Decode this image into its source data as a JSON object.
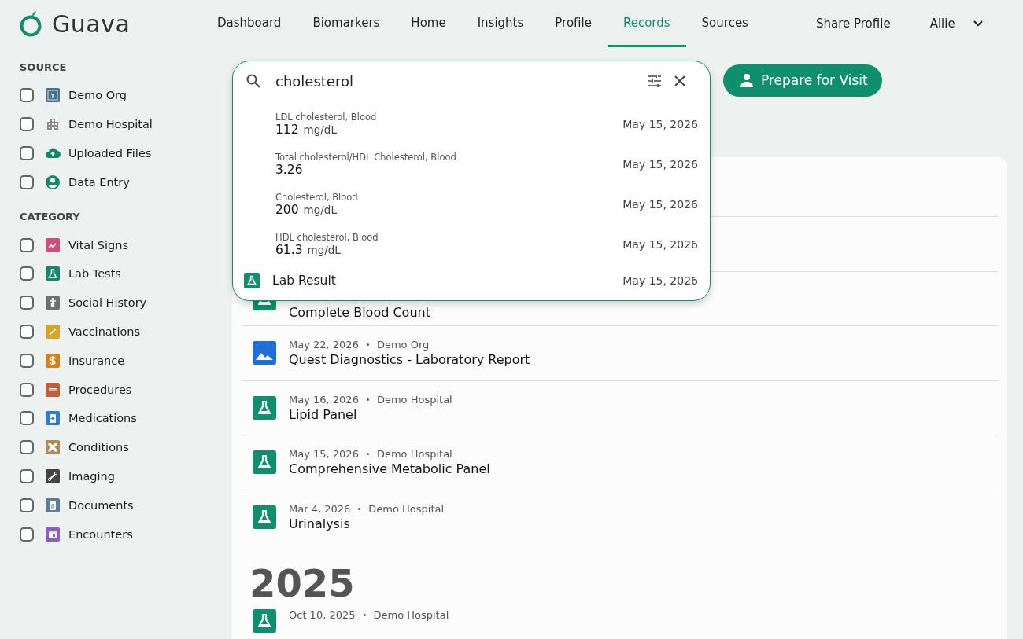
{
  "brand": {
    "name": "Guava"
  },
  "nav": [
    {
      "label": "Dashboard",
      "selected": false
    },
    {
      "label": "Biomarkers",
      "selected": false
    },
    {
      "label": "Home",
      "selected": false
    },
    {
      "label": "Insights",
      "selected": false
    },
    {
      "label": "Profile",
      "selected": false
    },
    {
      "label": "Records",
      "selected": true
    },
    {
      "label": "Sources",
      "selected": false
    }
  ],
  "share": "Share Profile",
  "user": "Allie",
  "sidebar": [
    {
      "title": "SOURCE",
      "items": [
        {
          "label": "Demo Org",
          "checked": false,
          "color": "#4a6f8f"
        },
        {
          "label": "Demo Hospital",
          "checked": false,
          "color": "#8a8a8a"
        },
        {
          "label": "Uploaded Files",
          "checked": false,
          "color": "#12896a"
        },
        {
          "label": "Data Entry",
          "checked": false,
          "color": "#12896a"
        }
      ]
    },
    {
      "title": "CATEGORY",
      "items": [
        {
          "label": "Vital Signs",
          "checked": false,
          "color": "#c9507a"
        },
        {
          "label": "Lab Tests",
          "checked": false,
          "color": "#12896a"
        },
        {
          "label": "Social History",
          "checked": false,
          "color": "#6f6f6f"
        },
        {
          "label": "Vaccinations",
          "checked": false,
          "color": "#d4a52a"
        },
        {
          "label": "Insurance",
          "checked": false,
          "color": "#d4821e"
        },
        {
          "label": "Procedures",
          "checked": false,
          "color": "#c0603a"
        },
        {
          "label": "Medications",
          "checked": false,
          "color": "#2f7ad8"
        },
        {
          "label": "Conditions",
          "checked": false,
          "color": "#b08a5a"
        },
        {
          "label": "Imaging",
          "checked": false,
          "color": "#444444"
        },
        {
          "label": "Documents",
          "checked": false,
          "color": "#5a7f94"
        },
        {
          "label": "Encounters",
          "checked": false,
          "color": "#8a5cc8"
        }
      ]
    }
  ],
  "search": {
    "value": "cholesterol",
    "results": [
      {
        "kind": "observation",
        "label": "LDL cholesterol, Blood",
        "value": "112",
        "unit": "mg/dL",
        "date": "May 15, 2026"
      },
      {
        "kind": "observation",
        "label": "Total cholesterol/HDL Cholesterol, Blood",
        "value": "3.26",
        "date": "May 15, 2026"
      },
      {
        "kind": "observation",
        "label": "Cholesterol, Blood",
        "value": "200",
        "unit": "mg/dL",
        "date": "May 15, 2026"
      },
      {
        "kind": "observation",
        "label": "HDL cholesterol, Blood",
        "value": "61.3",
        "unit": "mg/dL",
        "date": "May 15, 2026"
      },
      {
        "kind": "record",
        "label": "Lab Result",
        "date": "May 15, 2026"
      }
    ]
  },
  "prepare_button": "Prepare for Visit",
  "years": [
    {
      "records": [
        {
          "kind": "hidden"
        },
        {
          "kind": "hidden"
        },
        {
          "kind": "lab",
          "title": "Complete Blood Count"
        },
        {
          "kind": "image",
          "date": "May 22, 2026",
          "source": "Demo Org",
          "title": "Quest Diagnostics - Laboratory Report"
        },
        {
          "kind": "lab",
          "date": "May 16, 2026",
          "source": "Demo Hospital",
          "title": "Lipid Panel"
        },
        {
          "kind": "lab",
          "date": "May 15, 2026",
          "source": "Demo Hospital",
          "title": "Comprehensive Metabolic Panel"
        },
        {
          "kind": "lab",
          "date": "Mar 4, 2026",
          "source": "Demo Hospital",
          "title": "Urinalysis"
        }
      ]
    },
    {
      "year": "2025",
      "records": [
        {
          "kind": "lab",
          "date": "Oct 10, 2025",
          "source": "Demo Hospital"
        }
      ]
    }
  ]
}
